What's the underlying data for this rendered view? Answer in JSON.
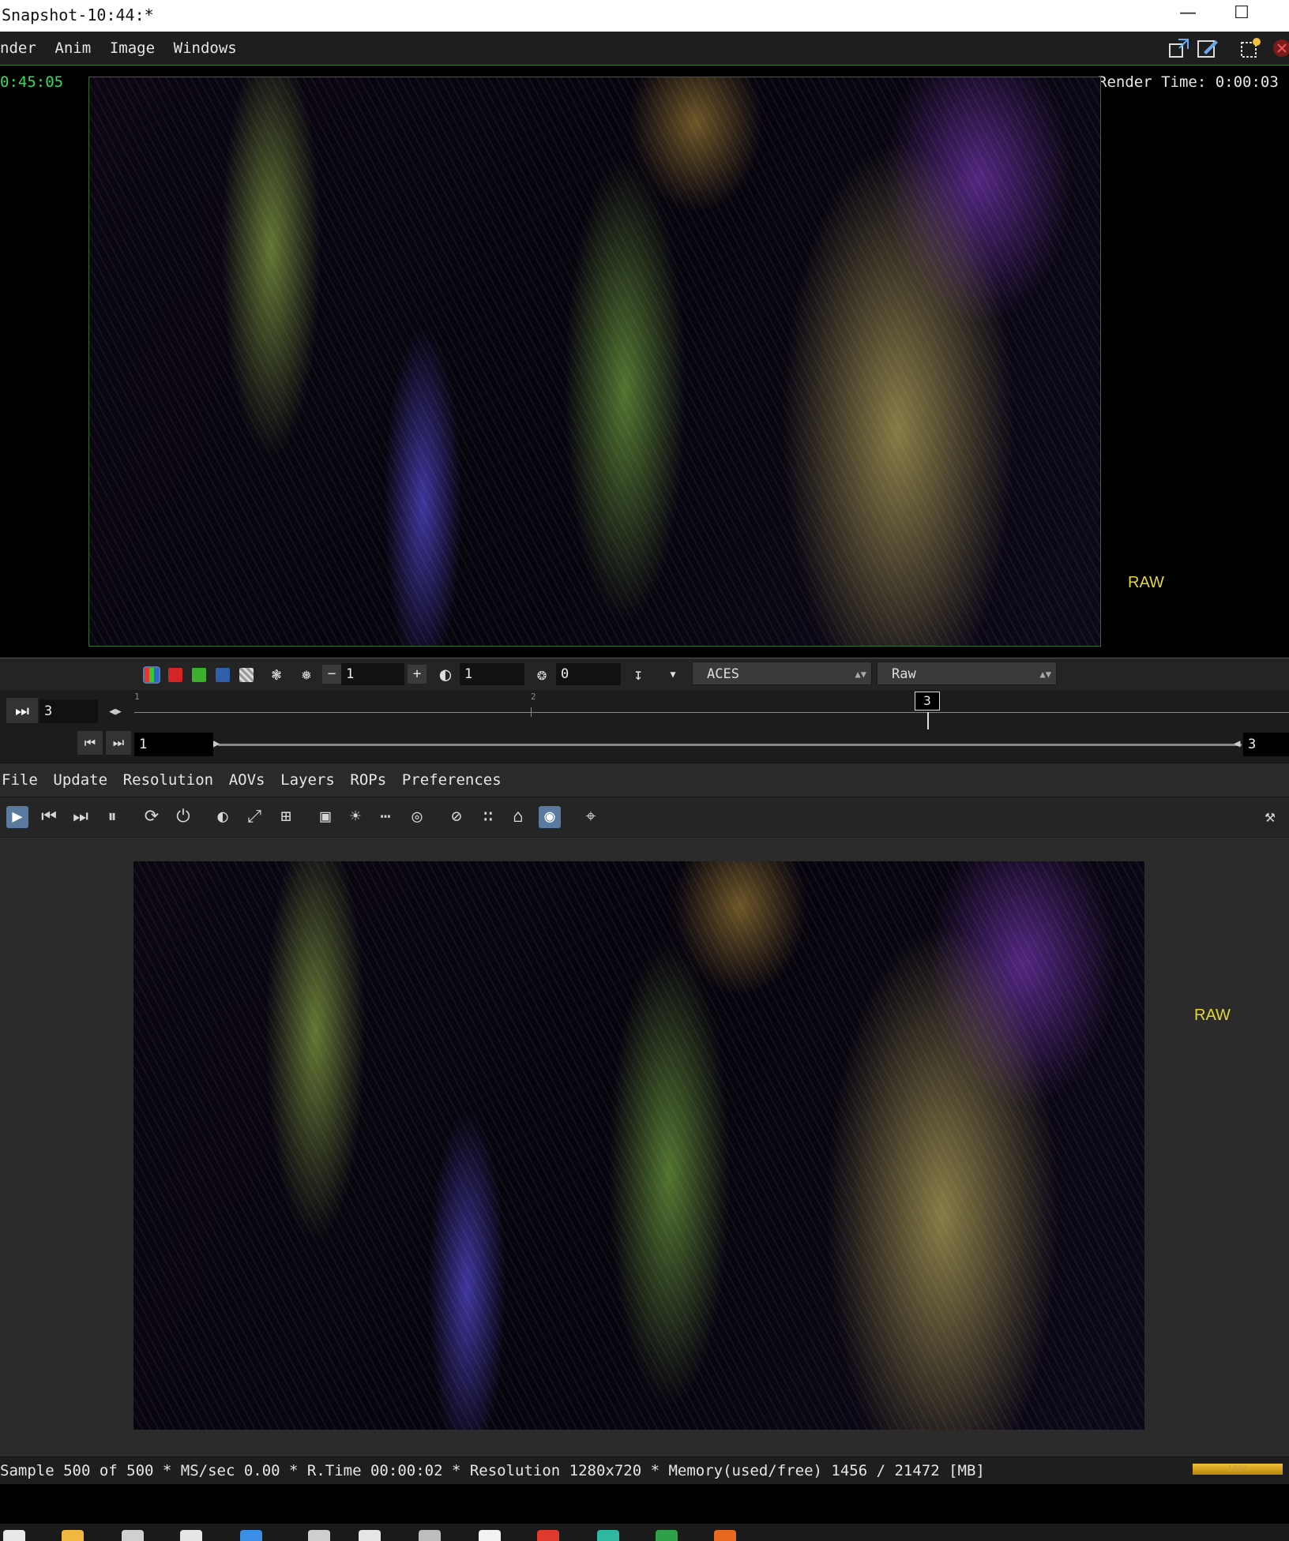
{
  "window": {
    "title": "Snapshot-10:44:*",
    "minimize_icon": "minimize-icon",
    "maximize_icon": "maximize-icon"
  },
  "top_menu": [
    "nder",
    "Anim",
    "Image",
    "Windows"
  ],
  "top_toolbar_icons": [
    "fit-view-icon",
    "edit-view-icon",
    "render-region-icon",
    "close-red-icon"
  ],
  "viewer_top": {
    "elapsed": "0:45:05",
    "render_time": "Render Time: 0:00:03",
    "overlay": "RAW"
  },
  "viewer_toolbar": {
    "exposure_value": "1",
    "gamma_value": "1",
    "offset_value": "0",
    "colorspace": "ACES",
    "view_transform": "Raw"
  },
  "timeline": {
    "current_frame": "3",
    "start_frame": "1",
    "end_frame": "3",
    "marker_label": "3",
    "tick_labels": [
      "1",
      "2"
    ]
  },
  "main_menu": [
    "File",
    "Update",
    "Resolution",
    "AOVs",
    "Layers",
    "ROPs",
    "Preferences"
  ],
  "viewer_bottom": {
    "overlay": "RAW"
  },
  "status": {
    "text": "Sample 500 of 500 * MS/sec 0.00 * R.Time 00:00:02 * Resolution 1280x720 * Memory(used/free) 1456 / 21472 [MB]",
    "progress_label": "100%",
    "progress": 1.0
  },
  "colors": {
    "accent_green": "#3a7a3a",
    "raw_label": "#e6d630",
    "progress": "#f0c13a",
    "elapsed_text": "#2ee05a"
  }
}
